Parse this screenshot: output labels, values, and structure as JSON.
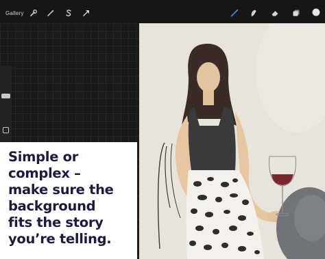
{
  "toolbar": {
    "gallery_label": "Gallery",
    "left_icons": [
      "wrench-icon",
      "magic-wand-icon",
      "selection-s-icon",
      "transform-arrow-icon"
    ],
    "right_icons": [
      "brush-icon",
      "smudge-icon",
      "eraser-icon",
      "layers-icon",
      "color-swatch"
    ],
    "active_tool_color": "#3f8ff5",
    "current_color": "#ece6dc"
  },
  "caption": {
    "text": "Simple or\ncomplex –\nmake sure the\nbackground\nfits the story\nyou’re telling.",
    "color": "#1d1a3f"
  }
}
